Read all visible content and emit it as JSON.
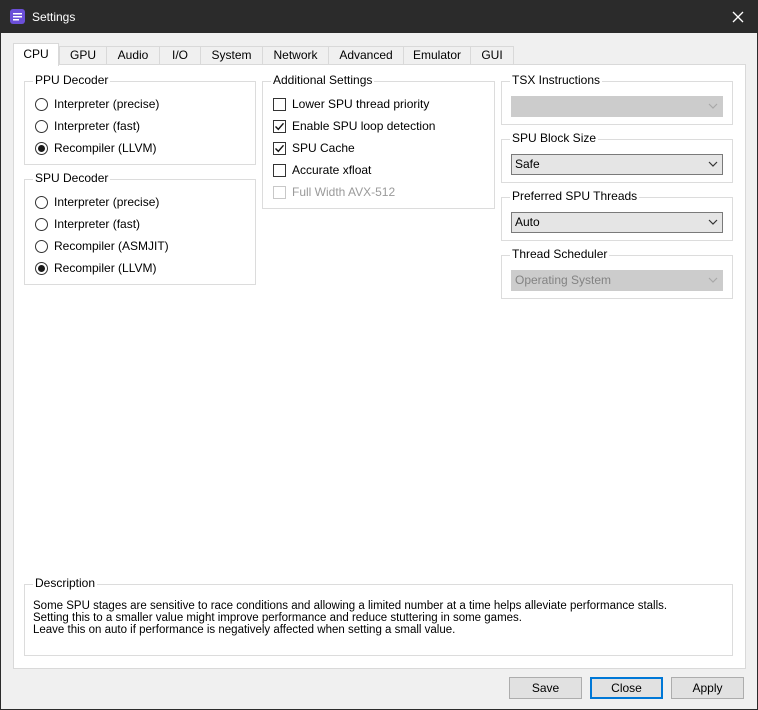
{
  "window": {
    "title": "Settings"
  },
  "tabs": [
    {
      "label": "CPU",
      "active": true
    },
    {
      "label": "GPU"
    },
    {
      "label": "Audio"
    },
    {
      "label": "I/O"
    },
    {
      "label": "System"
    },
    {
      "label": "Network"
    },
    {
      "label": "Advanced"
    },
    {
      "label": "Emulator"
    },
    {
      "label": "GUI"
    }
  ],
  "ppu_decoder": {
    "title": "PPU Decoder",
    "options": [
      {
        "label": "Interpreter (precise)",
        "checked": false
      },
      {
        "label": "Interpreter (fast)",
        "checked": false
      },
      {
        "label": "Recompiler (LLVM)",
        "checked": true
      }
    ]
  },
  "spu_decoder": {
    "title": "SPU Decoder",
    "options": [
      {
        "label": "Interpreter (precise)",
        "checked": false
      },
      {
        "label": "Interpreter (fast)",
        "checked": false
      },
      {
        "label": "Recompiler (ASMJIT)",
        "checked": false
      },
      {
        "label": "Recompiler (LLVM)",
        "checked": true
      }
    ]
  },
  "additional_settings": {
    "title": "Additional Settings",
    "options": [
      {
        "label": "Lower SPU thread priority",
        "checked": false,
        "enabled": true
      },
      {
        "label": "Enable SPU loop detection",
        "checked": true,
        "enabled": true
      },
      {
        "label": "SPU Cache",
        "checked": true,
        "enabled": true
      },
      {
        "label": "Accurate xfloat",
        "checked": false,
        "enabled": true
      },
      {
        "label": "Full Width AVX-512",
        "checked": false,
        "enabled": false
      }
    ]
  },
  "tsx_instructions": {
    "title": "TSX Instructions",
    "value": "",
    "enabled": false
  },
  "spu_block_size": {
    "title": "SPU Block Size",
    "value": "Safe",
    "enabled": true
  },
  "preferred_spu_threads": {
    "title": "Preferred SPU Threads",
    "value": "Auto",
    "enabled": true
  },
  "thread_scheduler": {
    "title": "Thread Scheduler",
    "value": "Operating System",
    "enabled": false
  },
  "description": {
    "title": "Description",
    "lines": [
      "Some SPU stages are sensitive to race conditions and allowing a limited number at a time helps alleviate performance stalls.",
      "Setting this to a smaller value might improve performance and reduce stuttering in some games.",
      "Leave this on auto if performance is negatively affected when setting a small value."
    ]
  },
  "buttons": {
    "save": "Save",
    "close": "Close",
    "apply": "Apply"
  },
  "colors": {
    "titlebar": "#2b2b2b",
    "accent": "#0078d7",
    "icon": "#6b4fd8"
  }
}
